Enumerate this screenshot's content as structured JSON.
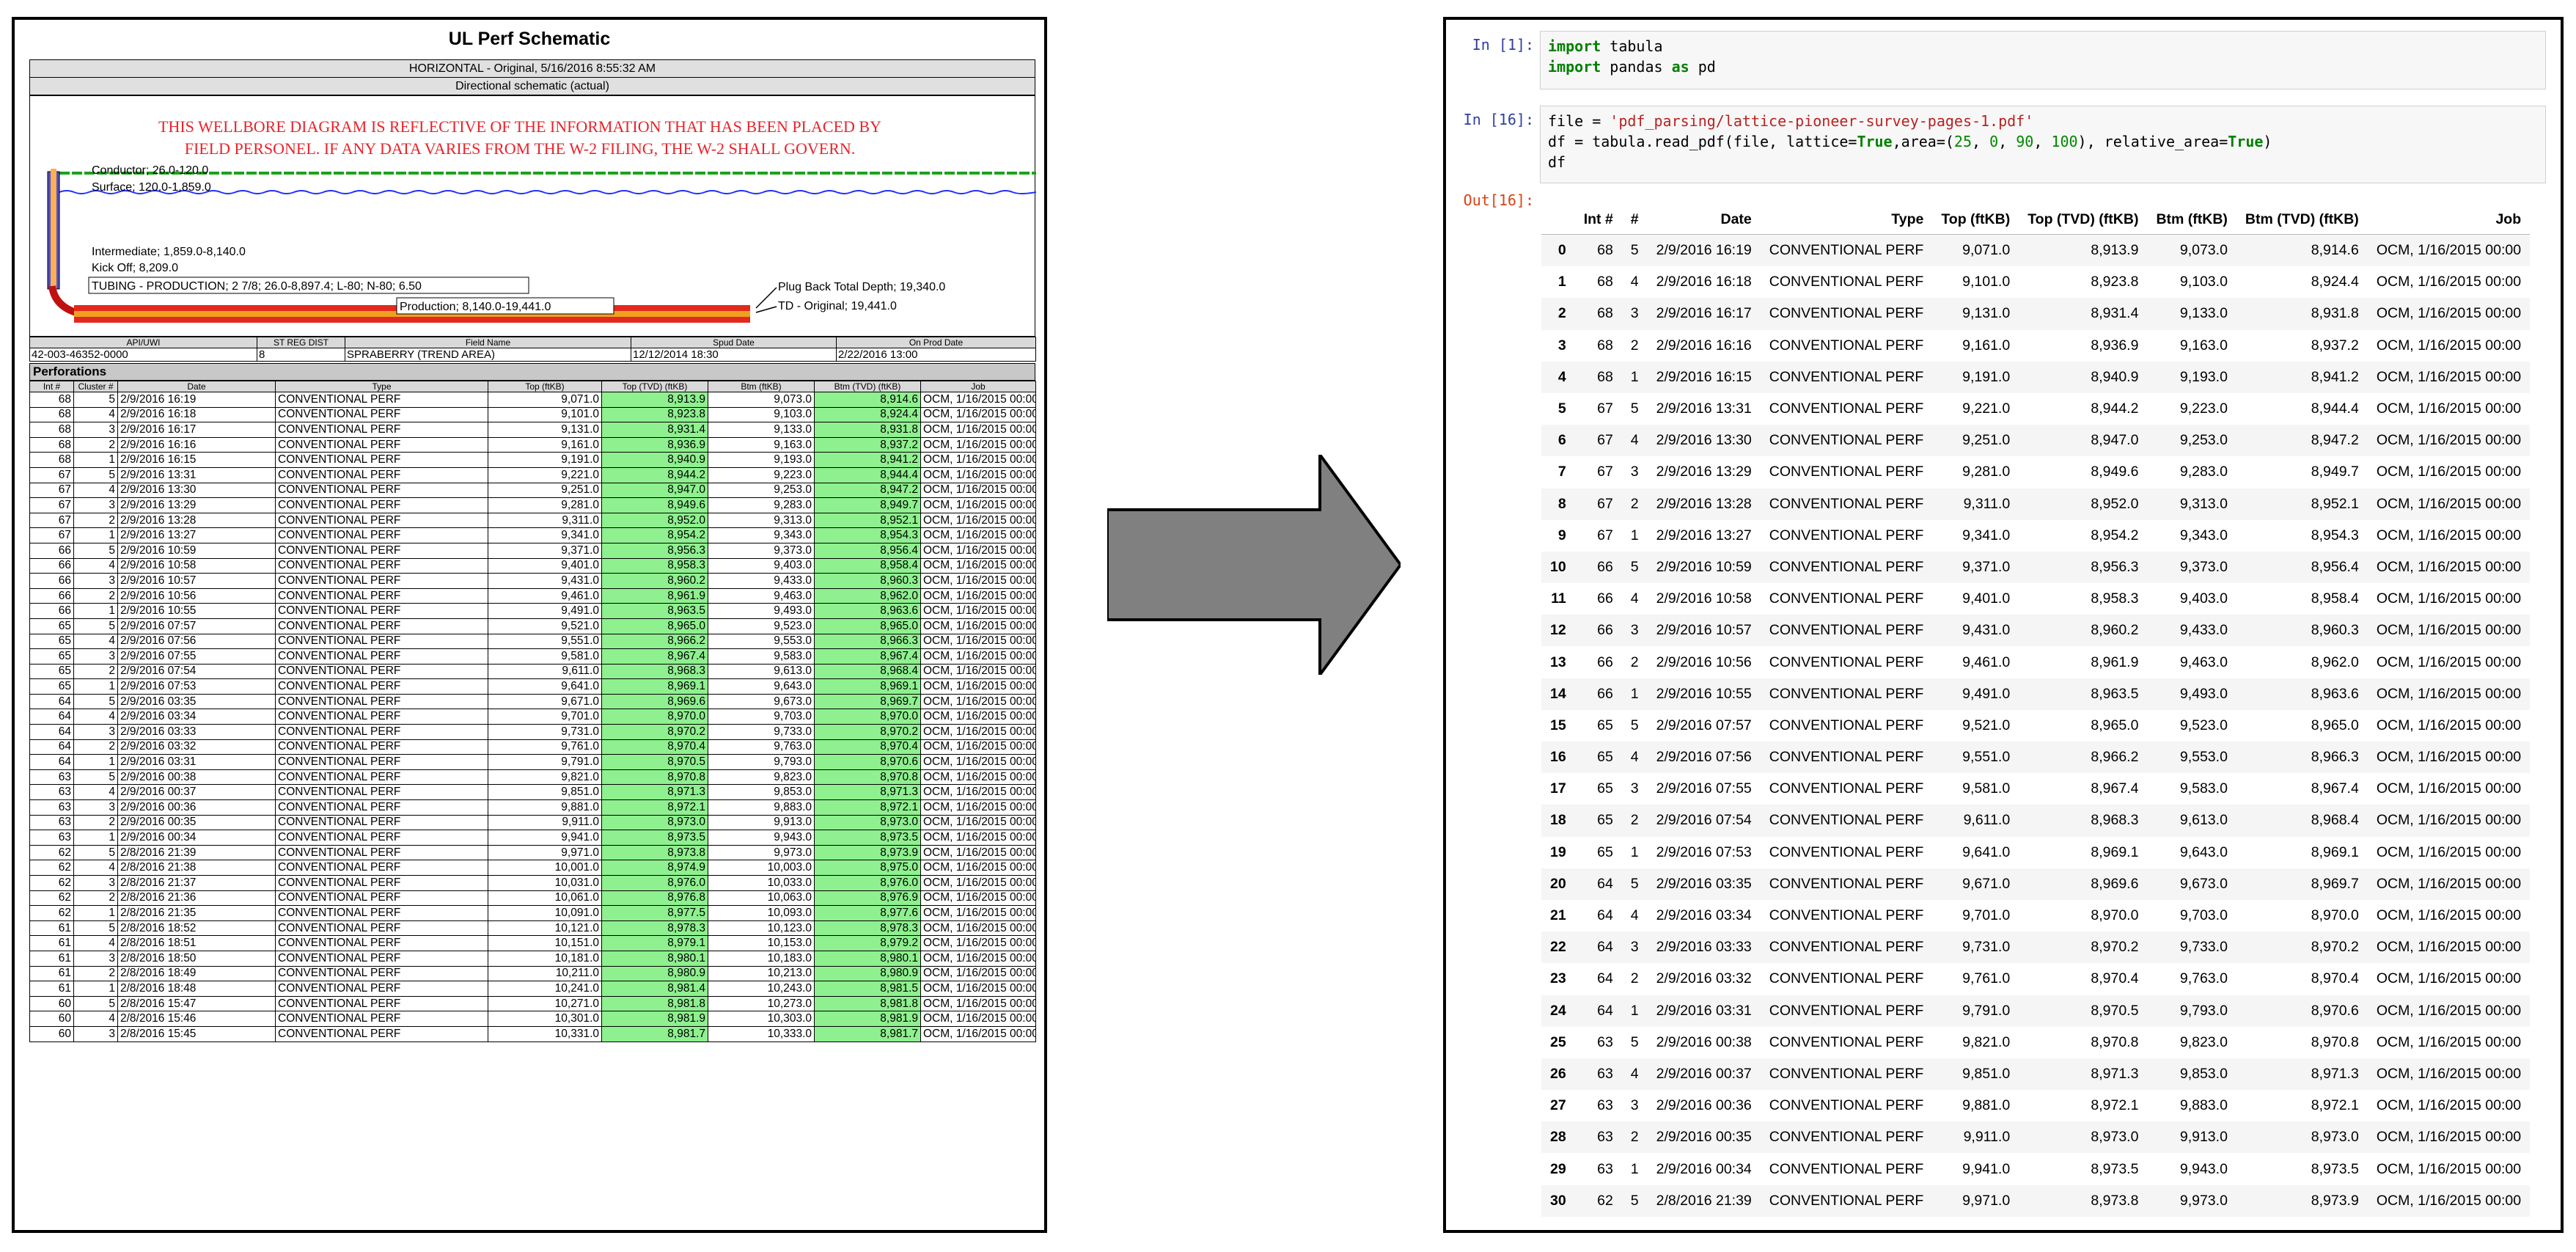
{
  "pdf": {
    "title": "UL Perf Schematic",
    "subtitle": "HORIZONTAL - Original, 5/16/2016 8:55:32 AM",
    "schematic_label": "Directional schematic (actual)",
    "warning_line1": "THIS WELLBORE DIAGRAM IS REFLECTIVE OF THE INFORMATION THAT HAS BEEN PLACED BY",
    "warning_line2": "FIELD PERSONEL.  IF ANY DATA VARIES FROM THE W-2 FILING, THE W-2 SHALL GOVERN.",
    "labels": {
      "conductor": "Conductor; 26.0-120.0",
      "surface": "Surface; 120.0-1,859.0",
      "intermediate": "Intermediate; 1,859.0-8,140.0",
      "kickoff": "Kick Off; 8,209.0",
      "tubing": "TUBING - PRODUCTION; 2 7/8; 26.0-8,897.4; L-80; N-80; 6.50",
      "production": "Production; 8,140.0-19,441.0",
      "plugback": "Plug Back Total Depth; 19,340.0",
      "td": "TD - Original; 19,441.0"
    },
    "well_info": {
      "headers": [
        "API/UWI",
        "ST REG DIST",
        "Field Name",
        "Spud Date",
        "On Prod Date"
      ],
      "values": [
        "42-003-46352-0000",
        "8",
        "SPRABERRY (TREND AREA)",
        "12/12/2014 18:30",
        "2/22/2016 13:00"
      ]
    },
    "perforations_title": "Perforations",
    "perf_headers": [
      "Int #",
      "Cluster #",
      "Date",
      "Type",
      "Top (ftKB)",
      "Top (TVD) (ftKB)",
      "Btm (ftKB)",
      "Btm (TVD) (ftKB)",
      "Job"
    ],
    "rows": [
      [
        "68",
        "5",
        "2/9/2016 16:19",
        "CONVENTIONAL PERF",
        "9,071.0",
        "8,913.9",
        "9,073.0",
        "8,914.6",
        "OCM, 1/16/2015 00:00"
      ],
      [
        "68",
        "4",
        "2/9/2016 16:18",
        "CONVENTIONAL PERF",
        "9,101.0",
        "8,923.8",
        "9,103.0",
        "8,924.4",
        "OCM, 1/16/2015 00:00"
      ],
      [
        "68",
        "3",
        "2/9/2016 16:17",
        "CONVENTIONAL PERF",
        "9,131.0",
        "8,931.4",
        "9,133.0",
        "8,931.8",
        "OCM, 1/16/2015 00:00"
      ],
      [
        "68",
        "2",
        "2/9/2016 16:16",
        "CONVENTIONAL PERF",
        "9,161.0",
        "8,936.9",
        "9,163.0",
        "8,937.2",
        "OCM, 1/16/2015 00:00"
      ],
      [
        "68",
        "1",
        "2/9/2016 16:15",
        "CONVENTIONAL PERF",
        "9,191.0",
        "8,940.9",
        "9,193.0",
        "8,941.2",
        "OCM, 1/16/2015 00:00"
      ],
      [
        "67",
        "5",
        "2/9/2016 13:31",
        "CONVENTIONAL PERF",
        "9,221.0",
        "8,944.2",
        "9,223.0",
        "8,944.4",
        "OCM, 1/16/2015 00:00"
      ],
      [
        "67",
        "4",
        "2/9/2016 13:30",
        "CONVENTIONAL PERF",
        "9,251.0",
        "8,947.0",
        "9,253.0",
        "8,947.2",
        "OCM, 1/16/2015 00:00"
      ],
      [
        "67",
        "3",
        "2/9/2016 13:29",
        "CONVENTIONAL PERF",
        "9,281.0",
        "8,949.6",
        "9,283.0",
        "8,949.7",
        "OCM, 1/16/2015 00:00"
      ],
      [
        "67",
        "2",
        "2/9/2016 13:28",
        "CONVENTIONAL PERF",
        "9,311.0",
        "8,952.0",
        "9,313.0",
        "8,952.1",
        "OCM, 1/16/2015 00:00"
      ],
      [
        "67",
        "1",
        "2/9/2016 13:27",
        "CONVENTIONAL PERF",
        "9,341.0",
        "8,954.2",
        "9,343.0",
        "8,954.3",
        "OCM, 1/16/2015 00:00"
      ],
      [
        "66",
        "5",
        "2/9/2016 10:59",
        "CONVENTIONAL PERF",
        "9,371.0",
        "8,956.3",
        "9,373.0",
        "8,956.4",
        "OCM, 1/16/2015 00:00"
      ],
      [
        "66",
        "4",
        "2/9/2016 10:58",
        "CONVENTIONAL PERF",
        "9,401.0",
        "8,958.3",
        "9,403.0",
        "8,958.4",
        "OCM, 1/16/2015 00:00"
      ],
      [
        "66",
        "3",
        "2/9/2016 10:57",
        "CONVENTIONAL PERF",
        "9,431.0",
        "8,960.2",
        "9,433.0",
        "8,960.3",
        "OCM, 1/16/2015 00:00"
      ],
      [
        "66",
        "2",
        "2/9/2016 10:56",
        "CONVENTIONAL PERF",
        "9,461.0",
        "8,961.9",
        "9,463.0",
        "8,962.0",
        "OCM, 1/16/2015 00:00"
      ],
      [
        "66",
        "1",
        "2/9/2016 10:55",
        "CONVENTIONAL PERF",
        "9,491.0",
        "8,963.5",
        "9,493.0",
        "8,963.6",
        "OCM, 1/16/2015 00:00"
      ],
      [
        "65",
        "5",
        "2/9/2016 07:57",
        "CONVENTIONAL PERF",
        "9,521.0",
        "8,965.0",
        "9,523.0",
        "8,965.0",
        "OCM, 1/16/2015 00:00"
      ],
      [
        "65",
        "4",
        "2/9/2016 07:56",
        "CONVENTIONAL PERF",
        "9,551.0",
        "8,966.2",
        "9,553.0",
        "8,966.3",
        "OCM, 1/16/2015 00:00"
      ],
      [
        "65",
        "3",
        "2/9/2016 07:55",
        "CONVENTIONAL PERF",
        "9,581.0",
        "8,967.4",
        "9,583.0",
        "8,967.4",
        "OCM, 1/16/2015 00:00"
      ],
      [
        "65",
        "2",
        "2/9/2016 07:54",
        "CONVENTIONAL PERF",
        "9,611.0",
        "8,968.3",
        "9,613.0",
        "8,968.4",
        "OCM, 1/16/2015 00:00"
      ],
      [
        "65",
        "1",
        "2/9/2016 07:53",
        "CONVENTIONAL PERF",
        "9,641.0",
        "8,969.1",
        "9,643.0",
        "8,969.1",
        "OCM, 1/16/2015 00:00"
      ],
      [
        "64",
        "5",
        "2/9/2016 03:35",
        "CONVENTIONAL PERF",
        "9,671.0",
        "8,969.6",
        "9,673.0",
        "8,969.7",
        "OCM, 1/16/2015 00:00"
      ],
      [
        "64",
        "4",
        "2/9/2016 03:34",
        "CONVENTIONAL PERF",
        "9,701.0",
        "8,970.0",
        "9,703.0",
        "8,970.0",
        "OCM, 1/16/2015 00:00"
      ],
      [
        "64",
        "3",
        "2/9/2016 03:33",
        "CONVENTIONAL PERF",
        "9,731.0",
        "8,970.2",
        "9,733.0",
        "8,970.2",
        "OCM, 1/16/2015 00:00"
      ],
      [
        "64",
        "2",
        "2/9/2016 03:32",
        "CONVENTIONAL PERF",
        "9,761.0",
        "8,970.4",
        "9,763.0",
        "8,970.4",
        "OCM, 1/16/2015 00:00"
      ],
      [
        "64",
        "1",
        "2/9/2016 03:31",
        "CONVENTIONAL PERF",
        "9,791.0",
        "8,970.5",
        "9,793.0",
        "8,970.6",
        "OCM, 1/16/2015 00:00"
      ],
      [
        "63",
        "5",
        "2/9/2016 00:38",
        "CONVENTIONAL PERF",
        "9,821.0",
        "8,970.8",
        "9,823.0",
        "8,970.8",
        "OCM, 1/16/2015 00:00"
      ],
      [
        "63",
        "4",
        "2/9/2016 00:37",
        "CONVENTIONAL PERF",
        "9,851.0",
        "8,971.3",
        "9,853.0",
        "8,971.3",
        "OCM, 1/16/2015 00:00"
      ],
      [
        "63",
        "3",
        "2/9/2016 00:36",
        "CONVENTIONAL PERF",
        "9,881.0",
        "8,972.1",
        "9,883.0",
        "8,972.1",
        "OCM, 1/16/2015 00:00"
      ],
      [
        "63",
        "2",
        "2/9/2016 00:35",
        "CONVENTIONAL PERF",
        "9,911.0",
        "8,973.0",
        "9,913.0",
        "8,973.0",
        "OCM, 1/16/2015 00:00"
      ],
      [
        "63",
        "1",
        "2/9/2016 00:34",
        "CONVENTIONAL PERF",
        "9,941.0",
        "8,973.5",
        "9,943.0",
        "8,973.5",
        "OCM, 1/16/2015 00:00"
      ],
      [
        "62",
        "5",
        "2/8/2016 21:39",
        "CONVENTIONAL PERF",
        "9,971.0",
        "8,973.8",
        "9,973.0",
        "8,973.9",
        "OCM, 1/16/2015 00:00"
      ],
      [
        "62",
        "4",
        "2/8/2016 21:38",
        "CONVENTIONAL PERF",
        "10,001.0",
        "8,974.9",
        "10,003.0",
        "8,975.0",
        "OCM, 1/16/2015 00:00"
      ],
      [
        "62",
        "3",
        "2/8/2016 21:37",
        "CONVENTIONAL PERF",
        "10,031.0",
        "8,976.0",
        "10,033.0",
        "8,976.0",
        "OCM, 1/16/2015 00:00"
      ],
      [
        "62",
        "2",
        "2/8/2016 21:36",
        "CONVENTIONAL PERF",
        "10,061.0",
        "8,976.8",
        "10,063.0",
        "8,976.9",
        "OCM, 1/16/2015 00:00"
      ],
      [
        "62",
        "1",
        "2/8/2016 21:35",
        "CONVENTIONAL PERF",
        "10,091.0",
        "8,977.5",
        "10,093.0",
        "8,977.6",
        "OCM, 1/16/2015 00:00"
      ],
      [
        "61",
        "5",
        "2/8/2016 18:52",
        "CONVENTIONAL PERF",
        "10,121.0",
        "8,978.3",
        "10,123.0",
        "8,978.3",
        "OCM, 1/16/2015 00:00"
      ],
      [
        "61",
        "4",
        "2/8/2016 18:51",
        "CONVENTIONAL PERF",
        "10,151.0",
        "8,979.1",
        "10,153.0",
        "8,979.2",
        "OCM, 1/16/2015 00:00"
      ],
      [
        "61",
        "3",
        "2/8/2016 18:50",
        "CONVENTIONAL PERF",
        "10,181.0",
        "8,980.1",
        "10,183.0",
        "8,980.1",
        "OCM, 1/16/2015 00:00"
      ],
      [
        "61",
        "2",
        "2/8/2016 18:49",
        "CONVENTIONAL PERF",
        "10,211.0",
        "8,980.9",
        "10,213.0",
        "8,980.9",
        "OCM, 1/16/2015 00:00"
      ],
      [
        "61",
        "1",
        "2/8/2016 18:48",
        "CONVENTIONAL PERF",
        "10,241.0",
        "8,981.4",
        "10,243.0",
        "8,981.5",
        "OCM, 1/16/2015 00:00"
      ],
      [
        "60",
        "5",
        "2/8/2016 15:47",
        "CONVENTIONAL PERF",
        "10,271.0",
        "8,981.8",
        "10,273.0",
        "8,981.8",
        "OCM, 1/16/2015 00:00"
      ],
      [
        "60",
        "4",
        "2/8/2016 15:46",
        "CONVENTIONAL PERF",
        "10,301.0",
        "8,981.9",
        "10,303.0",
        "8,981.9",
        "OCM, 1/16/2015 00:00"
      ],
      [
        "60",
        "3",
        "2/8/2016 15:45",
        "CONVENTIONAL PERF",
        "10,331.0",
        "8,981.7",
        "10,333.0",
        "8,981.7",
        "OCM, 1/16/2015 00:00"
      ]
    ]
  },
  "notebook": {
    "cell1_prompt": "In [1]:",
    "cell1_lines": [
      "import tabula",
      "import pandas as pd"
    ],
    "cell2_prompt": "In [16]:",
    "cell2_code": {
      "file_path": "'pdf_parsing/lattice-pioneer-survey-pages-1.pdf'",
      "read_call": "tabula.read_pdf(file, lattice=True,area=(25, 0, 90, 100), relative_area=True)",
      "last_line": "df"
    },
    "out_prompt": "Out[16]:",
    "df_headers": [
      "",
      "Int #",
      "#",
      "Date",
      "Type",
      "Top (ftKB)",
      "Top (TVD) (ftKB)",
      "Btm (ftKB)",
      "Btm (TVD) (ftKB)",
      "Job"
    ],
    "df_row_count": 31
  },
  "colors": {
    "tvd_highlight": "#8ef08e",
    "warning_text": "#e8232a",
    "arrow_fill": "#808080",
    "prompt_in": "#303f9f",
    "prompt_out": "#d84315"
  }
}
